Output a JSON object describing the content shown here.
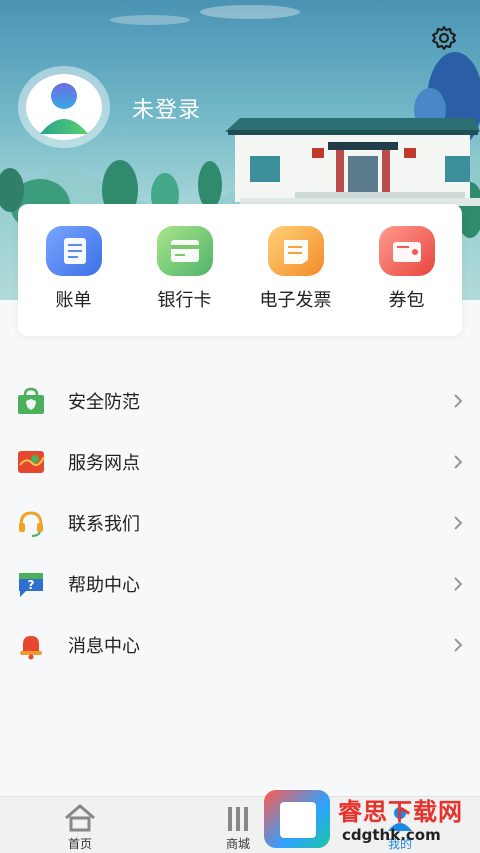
{
  "header": {
    "login_status": "未登录",
    "settings_icon": "gear-icon",
    "avatar_icon": "user-avatar-icon"
  },
  "shortcuts": [
    {
      "label": "账单",
      "icon": "bill-icon",
      "color": "#3e6fe6"
    },
    {
      "label": "银行卡",
      "icon": "bank-card-icon",
      "color": "#4fb46a"
    },
    {
      "label": "电子发票",
      "icon": "e-invoice-icon",
      "color": "#f28c27"
    },
    {
      "label": "券包",
      "icon": "coupon-wallet-icon",
      "color": "#e7453e"
    }
  ],
  "menu": [
    {
      "label": "安全防范",
      "icon": "shield-bag-icon"
    },
    {
      "label": "服务网点",
      "icon": "map-location-icon"
    },
    {
      "label": "联系我们",
      "icon": "headset-icon"
    },
    {
      "label": "帮助中心",
      "icon": "help-question-icon"
    },
    {
      "label": "消息中心",
      "icon": "bell-icon"
    }
  ],
  "bottom_nav": [
    {
      "label": "首页",
      "icon": "home-icon"
    },
    {
      "label": "商城",
      "icon": "store-icon"
    },
    {
      "label": "我的",
      "icon": "profile-icon"
    }
  ],
  "watermark": {
    "title": "睿思下载网",
    "url": "cdgthk.com"
  }
}
